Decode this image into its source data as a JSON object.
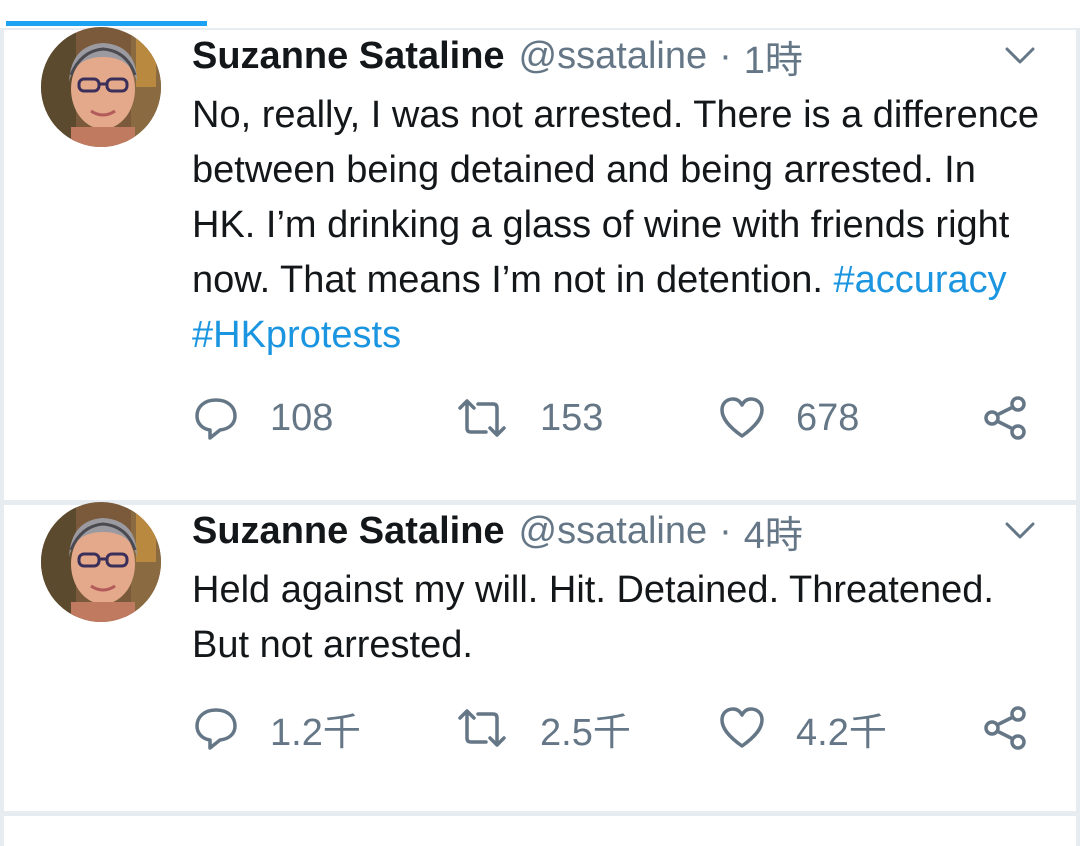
{
  "tweets": [
    {
      "name": "Suzanne Sataline",
      "handle": "@ssataline",
      "separator": "·",
      "time": "1時",
      "text": "No, really, I was not arrested. There is a difference between being detained and being arrested. In HK. I’m drinking a glass of wine with friends right now. That means I’m not in detention. ",
      "hashtags": [
        "#accuracy",
        "#HKprotests"
      ],
      "replies": "108",
      "retweets": "153",
      "likes": "678"
    },
    {
      "name": "Suzanne Sataline",
      "handle": "@ssataline",
      "separator": "·",
      "time": "4時",
      "text": "Held against my will. Hit. Detained. Threatened. But not arrested.",
      "replies": "1.2千",
      "retweets": "2.5千",
      "likes": "4.2千"
    }
  ],
  "icons": {
    "reply": "reply-icon",
    "retweet": "retweet-icon",
    "like": "heart-icon",
    "share": "share-icon",
    "menu": "chevron-down-icon"
  },
  "colors": {
    "accent": "#1da1f2",
    "hashtag": "#1b95e0",
    "secondary_text": "#657786",
    "background": "#e6ecf0"
  }
}
